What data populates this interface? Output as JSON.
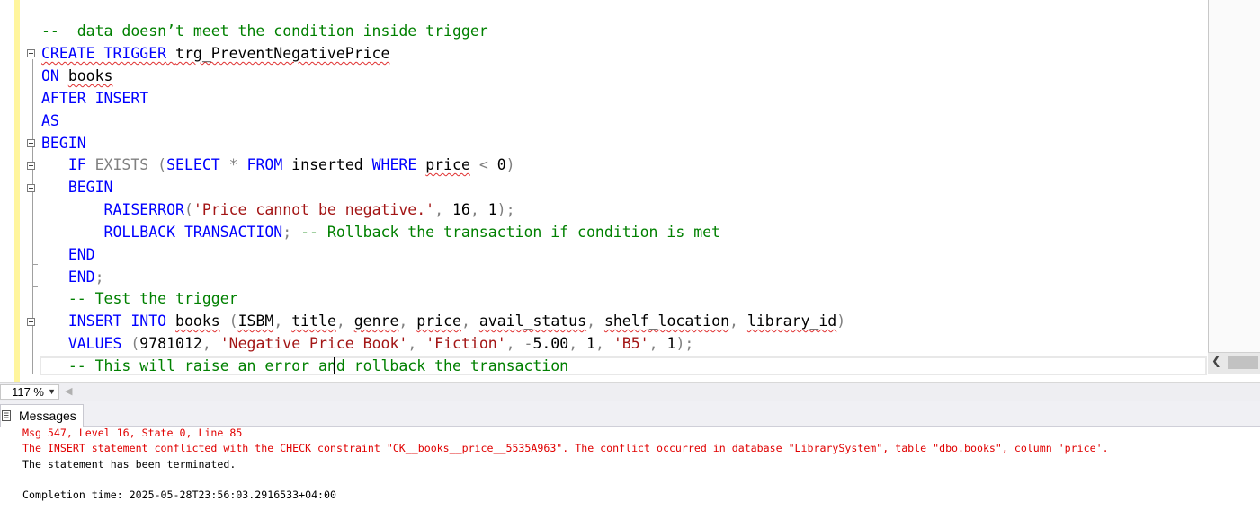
{
  "editor": {
    "lines": [
      {
        "tokens": [
          {
            "t": "--  data doesn’t meet the condition inside trigger",
            "c": "cm"
          }
        ]
      },
      {
        "tokens": [
          {
            "t": "CREATE TRIGGER",
            "c": "kw sq"
          },
          {
            "t": " ",
            "c": "sq"
          },
          {
            "t": "trg_PreventNegativePrice",
            "c": "sq"
          }
        ]
      },
      {
        "tokens": [
          {
            "t": "ON",
            "c": "kw"
          },
          {
            "t": " "
          },
          {
            "t": "books",
            "c": "sq"
          }
        ]
      },
      {
        "tokens": [
          {
            "t": "AFTER INSERT",
            "c": "kw"
          }
        ]
      },
      {
        "tokens": [
          {
            "t": "AS",
            "c": "kw"
          }
        ]
      },
      {
        "tokens": [
          {
            "t": "BEGIN",
            "c": "kw"
          }
        ]
      },
      {
        "tokens": [
          {
            "t": "   "
          },
          {
            "t": "IF",
            "c": "kw"
          },
          {
            "t": " "
          },
          {
            "t": "EXISTS",
            "c": "gray"
          },
          {
            "t": " (",
            "c": "gray"
          },
          {
            "t": "SELECT",
            "c": "kw"
          },
          {
            "t": " "
          },
          {
            "t": "*",
            "c": "gray"
          },
          {
            "t": " "
          },
          {
            "t": "FROM",
            "c": "kw"
          },
          {
            "t": " inserted "
          },
          {
            "t": "WHERE",
            "c": "kw"
          },
          {
            "t": " "
          },
          {
            "t": "price",
            "c": "sq"
          },
          {
            "t": " "
          },
          {
            "t": "<",
            "c": "gray"
          },
          {
            "t": " 0"
          },
          {
            "t": ")",
            "c": "gray"
          }
        ]
      },
      {
        "tokens": [
          {
            "t": "   "
          },
          {
            "t": "BEGIN",
            "c": "kw"
          }
        ]
      },
      {
        "tokens": [
          {
            "t": "       "
          },
          {
            "t": "RAISERROR",
            "c": "kw"
          },
          {
            "t": "(",
            "c": "gray"
          },
          {
            "t": "'Price cannot be negative.'",
            "c": "str"
          },
          {
            "t": ",",
            "c": "gray"
          },
          {
            "t": " 16"
          },
          {
            "t": ",",
            "c": "gray"
          },
          {
            "t": " 1"
          },
          {
            "t": ");",
            "c": "gray"
          }
        ]
      },
      {
        "tokens": [
          {
            "t": "       "
          },
          {
            "t": "ROLLBACK TRANSACTION",
            "c": "kw"
          },
          {
            "t": ";",
            "c": "gray"
          },
          {
            "t": " -- Rollback the transaction if condition is met",
            "c": "cm"
          }
        ]
      },
      {
        "tokens": [
          {
            "t": "   "
          },
          {
            "t": "END",
            "c": "kw"
          }
        ]
      },
      {
        "tokens": [
          {
            "t": "   "
          },
          {
            "t": "END",
            "c": "kw"
          },
          {
            "t": ";",
            "c": "gray"
          }
        ]
      },
      {
        "tokens": [
          {
            "t": "   "
          },
          {
            "t": "-- Test the trigger",
            "c": "cm"
          }
        ]
      },
      {
        "tokens": [
          {
            "t": "   "
          },
          {
            "t": "INSERT INTO",
            "c": "kw"
          },
          {
            "t": " "
          },
          {
            "t": "books",
            "c": "sq"
          },
          {
            "t": " (",
            "c": "gray"
          },
          {
            "t": "ISBM",
            "c": "sq"
          },
          {
            "t": ",",
            "c": "gray"
          },
          {
            "t": " "
          },
          {
            "t": "title",
            "c": "sq"
          },
          {
            "t": ",",
            "c": "gray"
          },
          {
            "t": " "
          },
          {
            "t": "genre",
            "c": "sq"
          },
          {
            "t": ",",
            "c": "gray"
          },
          {
            "t": " "
          },
          {
            "t": "price",
            "c": "sq"
          },
          {
            "t": ",",
            "c": "gray"
          },
          {
            "t": " "
          },
          {
            "t": "avail_status",
            "c": "sq"
          },
          {
            "t": ",",
            "c": "gray"
          },
          {
            "t": " "
          },
          {
            "t": "shelf_location",
            "c": "sq"
          },
          {
            "t": ",",
            "c": "gray"
          },
          {
            "t": " "
          },
          {
            "t": "library_id",
            "c": "sq"
          },
          {
            "t": ")",
            "c": "gray"
          }
        ]
      },
      {
        "tokens": [
          {
            "t": "   "
          },
          {
            "t": "VALUES",
            "c": "kw"
          },
          {
            "t": " (",
            "c": "gray"
          },
          {
            "t": "9781012"
          },
          {
            "t": ",",
            "c": "gray"
          },
          {
            "t": " "
          },
          {
            "t": "'Negative Price Book'",
            "c": "str"
          },
          {
            "t": ",",
            "c": "gray"
          },
          {
            "t": " "
          },
          {
            "t": "'Fiction'",
            "c": "str"
          },
          {
            "t": ",",
            "c": "gray"
          },
          {
            "t": " "
          },
          {
            "t": "-",
            "c": "gray"
          },
          {
            "t": "5.00"
          },
          {
            "t": ",",
            "c": "gray"
          },
          {
            "t": " 1"
          },
          {
            "t": ",",
            "c": "gray"
          },
          {
            "t": " "
          },
          {
            "t": "'B5'",
            "c": "str"
          },
          {
            "t": ",",
            "c": "gray"
          },
          {
            "t": " 1"
          },
          {
            "t": ");",
            "c": "gray"
          }
        ]
      },
      {
        "tokens": [
          {
            "t": "   "
          },
          {
            "t": "-- This will raise an error and rollback the transaction",
            "c": "cm"
          }
        ]
      }
    ]
  },
  "zoom": {
    "value": "117 %"
  },
  "results_tab": {
    "label": "Messages"
  },
  "messages": [
    {
      "text": "Msg 547, Level 16, State 0, Line 85",
      "color": "red"
    },
    {
      "text": "The INSERT statement conflicted with the CHECK constraint \"CK__books__price__5535A963\". The conflict occurred in database \"LibrarySystem\", table \"dbo.books\", column 'price'.",
      "color": "red"
    },
    {
      "text": "The statement has been terminated.",
      "color": "black"
    },
    {
      "text": "",
      "color": "black"
    },
    {
      "text": "Completion time: 2025-05-28T23:56:03.2916533+04:00",
      "color": "black"
    }
  ],
  "colors": {
    "keyword": "#0000ff",
    "string": "#a31515",
    "comment": "#008000",
    "operator": "#808080",
    "error": "#e00000",
    "change_bar": "#fff59d"
  }
}
